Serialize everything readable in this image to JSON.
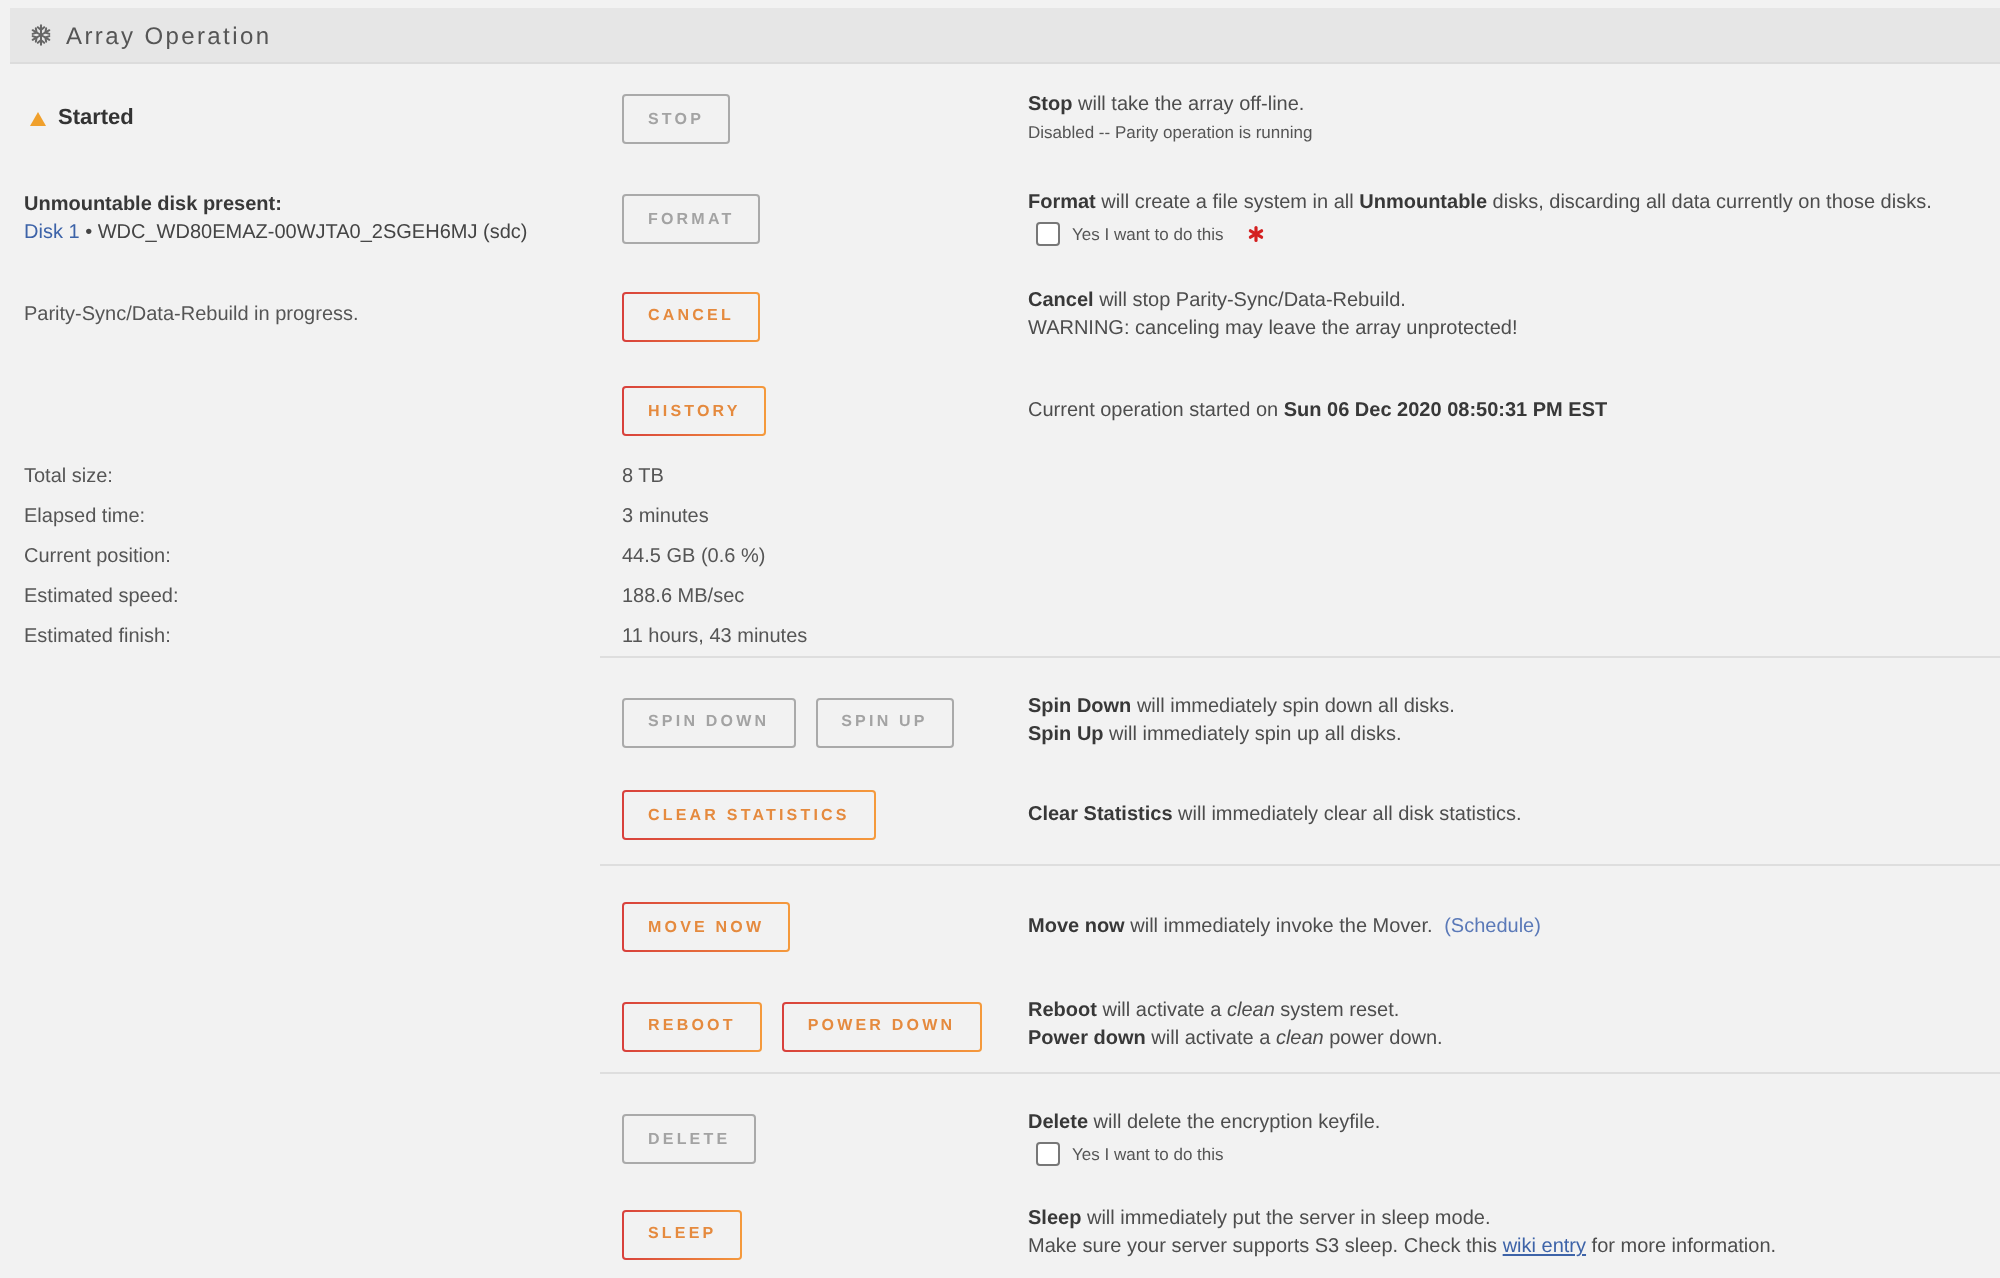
{
  "panel": {
    "title": "Array Operation"
  },
  "groups": [
    {
      "rows": [
        {
          "kind": "action",
          "left": {
            "kind": "status",
            "text": "Started"
          },
          "buttons": [
            {
              "label": "STOP",
              "disabled": true
            }
          ],
          "lines": [
            {
              "text": "**Stop** will take the array off-line."
            }
          ],
          "note": "Disabled -- Parity operation is running"
        },
        {
          "kind": "action",
          "left": {
            "kind": "disk",
            "title": "Unmountable disk present:",
            "link": "Disk 1",
            "detail": "• WDC_WD80EMAZ-00WJTA0_2SGEH6MJ (sdc)"
          },
          "buttons": [
            {
              "label": "FORMAT",
              "disabled": true
            }
          ],
          "lines": [
            {
              "text": "**Format** will create a file system in all **Unmountable** disks, discarding all data currently on those disks."
            }
          ],
          "confirm": {
            "label": "Yes I want to do this",
            "checked": false,
            "required": true
          }
        },
        {
          "kind": "action",
          "left": {
            "kind": "text",
            "text": "Parity-Sync/Data-Rebuild in progress."
          },
          "buttons": [
            {
              "label": "CANCEL",
              "disabled": false
            }
          ],
          "lines": [
            {
              "text": "**Cancel** will stop Parity-Sync/Data-Rebuild."
            },
            {
              "text": "WARNING: canceling may leave the array unprotected!"
            }
          ]
        },
        {
          "kind": "action",
          "buttons": [
            {
              "label": "HISTORY",
              "disabled": false
            }
          ],
          "lines": [
            {
              "text": "Current operation started on **Sun 06 Dec 2020 08:50:31 PM EST**"
            }
          ]
        },
        {
          "kind": "stat",
          "label": "Total size:",
          "value": "8 TB"
        },
        {
          "kind": "stat",
          "label": "Elapsed time:",
          "value": "3 minutes"
        },
        {
          "kind": "stat",
          "label": "Current position:",
          "value": "44.5 GB (0.6 %)"
        },
        {
          "kind": "stat",
          "label": "Estimated speed:",
          "value": "188.6 MB/sec"
        },
        {
          "kind": "stat",
          "label": "Estimated finish:",
          "value": "11 hours, 43 minutes"
        }
      ]
    },
    {
      "rows": [
        {
          "kind": "action",
          "buttons": [
            {
              "label": "SPIN DOWN",
              "disabled": true
            },
            {
              "label": "SPIN UP",
              "disabled": true
            }
          ],
          "lines": [
            {
              "text": "**Spin Down** will immediately spin down all disks."
            },
            {
              "text": "**Spin Up** will immediately spin up all disks."
            }
          ]
        },
        {
          "kind": "action",
          "buttons": [
            {
              "label": "CLEAR STATISTICS",
              "disabled": false
            }
          ],
          "lines": [
            {
              "text": "**Clear Statistics** will immediately clear all disk statistics."
            }
          ]
        }
      ]
    },
    {
      "rows": [
        {
          "kind": "action",
          "buttons": [
            {
              "label": "MOVE NOW",
              "disabled": false
            }
          ],
          "lines": [
            {
              "text": "**Move now** will immediately invoke the Mover.",
              "link": "(Schedule)"
            }
          ]
        },
        {
          "kind": "action",
          "buttons": [
            {
              "label": "REBOOT",
              "disabled": false
            },
            {
              "label": "POWER DOWN",
              "disabled": false
            }
          ],
          "lines": [
            {
              "text": "**Reboot** will activate a *clean* system reset."
            },
            {
              "text": "**Power down** will activate a *clean* power down."
            }
          ]
        }
      ]
    },
    {
      "rows": [
        {
          "kind": "action",
          "buttons": [
            {
              "label": "DELETE",
              "disabled": true
            }
          ],
          "lines": [
            {
              "text": "**Delete** will delete the encryption keyfile."
            }
          ],
          "confirm": {
            "label": "Yes I want to do this",
            "checked": false,
            "required": false
          }
        },
        {
          "kind": "action",
          "buttons": [
            {
              "label": "SLEEP",
              "disabled": false
            }
          ],
          "lines": [
            {
              "text": "**Sleep** will immediately put the server in sleep mode."
            },
            {
              "text": "Make sure your server supports S3 sleep. Check this",
              "link": "wiki entry",
              "after": "for more information."
            }
          ]
        }
      ]
    }
  ]
}
